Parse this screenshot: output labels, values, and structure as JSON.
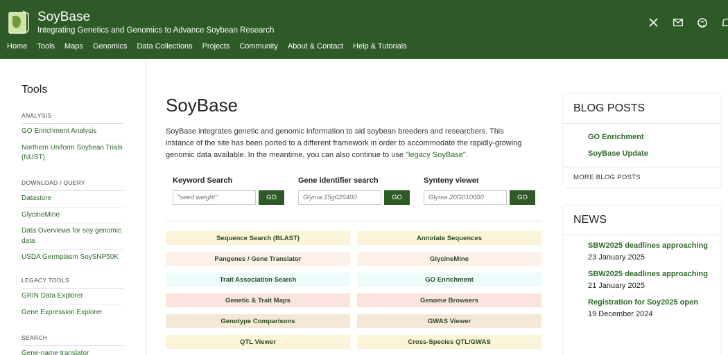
{
  "header": {
    "title": "SoyBase",
    "tagline": "Integrating Genetics and Genomics to Advance Soybean Research",
    "icons": [
      "x-icon",
      "mail-icon",
      "github-icon",
      "bell-icon"
    ],
    "colors": {
      "brand": "#2e5a27",
      "link": "#2e6a2a"
    }
  },
  "nav": [
    "Home",
    "Tools",
    "Maps",
    "Genomics",
    "Data Collections",
    "Projects",
    "Community",
    "About & Contact",
    "Help & Tutorials"
  ],
  "sidebar": {
    "title": "Tools",
    "sections": [
      {
        "heading": "ANALYSIS",
        "links": [
          "GO Enrichment Analysis",
          "Northern Uniform Soybean Trials (NUST)"
        ]
      },
      {
        "heading": "DOWNLOAD / QUERY",
        "links": [
          "Datastore",
          "GlycineMine",
          "Data Overviews for soy genomic data",
          "USDA Germplasm SoySNP50K"
        ]
      },
      {
        "heading": "LEGACY TOOLS",
        "links": [
          "GRIN Data Explorer",
          "Gene Expression Explorer"
        ]
      },
      {
        "heading": "SEARCH",
        "links": [
          "Gene-name translator"
        ]
      }
    ]
  },
  "main": {
    "title": "SoyBase",
    "desc_before": "SoyBase integrates genetic and genomic information to aid soybean breeders and researchers. This instance of the site has been ported to a different framework in order to accommodate the rapidly-growing genomic data available. In the meantime, you can also continue to use ",
    "desc_link": "\"legacy SoyBase\"",
    "desc_after": ".",
    "searches": [
      {
        "label": "Keyword Search",
        "placeholder": "\"seed weight\"",
        "button": "GO"
      },
      {
        "label": "Gene identifier search",
        "placeholder": "Glyma.15g026400",
        "button": "GO"
      },
      {
        "label": "Synteny viewer",
        "placeholder": "Glyma.20G010000",
        "button": "GO"
      }
    ],
    "tools": [
      {
        "label": "Sequence Search (BLAST)",
        "color": "#fcf4d9"
      },
      {
        "label": "Annotate Sequences",
        "color": "#fcf4d9"
      },
      {
        "label": "Pangenes / Gene Translator",
        "color": "#fdf1ea"
      },
      {
        "label": "GlycineMine",
        "color": "#fdf1ea"
      },
      {
        "label": "Trait Association Search",
        "color": "#eefbfb"
      },
      {
        "label": "GO Enrichment",
        "color": "#eefbfb"
      },
      {
        "label": "Genetic & Trait Maps",
        "color": "#fbe3df"
      },
      {
        "label": "Genome Browsers",
        "color": "#fbe3df"
      },
      {
        "label": "Genotype Comparisons",
        "color": "#f5e8d8"
      },
      {
        "label": "GWAS Viewer",
        "color": "#f5e8d8"
      },
      {
        "label": "QTL Viewer",
        "color": "#fcf4d9"
      },
      {
        "label": "Cross-Species QTL/GWAS",
        "color": "#fcf4d9"
      }
    ]
  },
  "blog": {
    "heading": "BLOG POSTS",
    "items": [
      "GO Enrichment",
      "SoyBase Update"
    ],
    "more": "MORE BLOG POSTS"
  },
  "news": {
    "heading": "NEWS",
    "items": [
      {
        "title": "SBW2025 deadlines approaching",
        "date": "23 January 2025"
      },
      {
        "title": "SBW2025 deadlines approaching",
        "date": "21 January 2025"
      },
      {
        "title": "Registration for Soy2025 open",
        "date": "19 December 2024"
      }
    ]
  }
}
